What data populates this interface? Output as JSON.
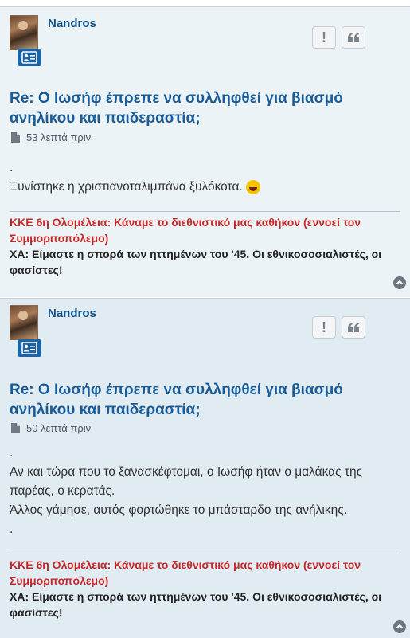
{
  "posts": [
    {
      "username": "Nandros",
      "title": "Re: Ο Ιωσήφ έπρεπε να συλληφθεί για βιασμό ανηλίκου και παιδεραστία;",
      "time": "53 λεπτά πριν",
      "lines": [
        ".",
        "Ξυνίστηκε η χριστιανοταλιμπάνα ξυλόκοτα."
      ],
      "emoji": "laughing-crying-emoji",
      "signature": {
        "line1": "ΚΚΕ 6η Ολομέλεια: Κάναμε το διεθνιστικό μας καθήκον (εννοεί τον Συμμοριτοπόλεμο)",
        "line2": "ΧΑ: Είμαστε η σπορά των ηττημένων του '45. Οι εθνικοσοσιαλιστές, οι φασίστες!"
      }
    },
    {
      "username": "Nandros",
      "title": "Re: Ο Ιωσήφ έπρεπε να συλληφθεί για βιασμό ανηλίκου και παιδεραστία;",
      "time": "50 λεπτά πριν",
      "lines": [
        ".",
        "Αν και τώρα που το ξανασκέφτομαι, ο Ιωσήφ ήταν ο μαλάκας της παρέας, ο κερατάς.",
        "Άλλος γάμησε, αυτός φορτώθηκε το μπάσταρδο της ανήλικης.",
        "."
      ],
      "signature": {
        "line1": "ΚΚΕ 6η Ολομέλεια: Κάναμε το διεθνιστικό μας καθήκον (εννοεί τον Συμμοριτοπόλεμο)",
        "line2": "ΧΑ: Είμαστε η σπορά των ηττημένων του '45. Οι εθνικοσοσιαλιστές, οι φασίστες!"
      }
    }
  ],
  "buttons": {
    "report": "!",
    "quote": "❝"
  },
  "icons": {
    "post": "file-icon",
    "profile": "id-card-icon",
    "top": "arrow-up-icon"
  },
  "colors": {
    "accent": "#105289",
    "signature_red": "#c62828"
  }
}
